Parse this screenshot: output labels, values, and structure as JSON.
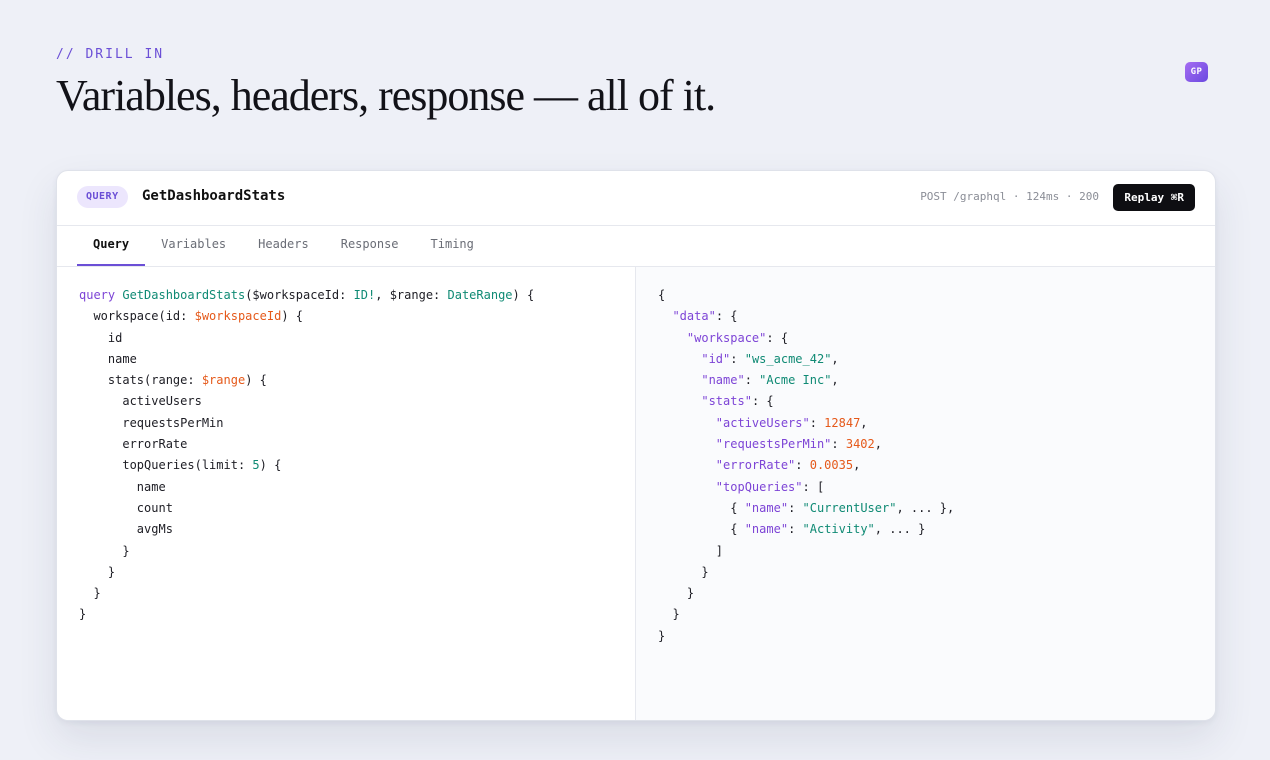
{
  "section": {
    "eyebrow": "// DRILL IN",
    "headline": "Variables, headers, response — all of it.",
    "corner_badge": "GP"
  },
  "panel": {
    "op_type": "QUERY",
    "op_name": "GetDashboardStats",
    "meta": "POST /graphql · 124ms · 200",
    "replay_label": "Replay ⌘R",
    "tabs": [
      "Query",
      "Variables",
      "Headers",
      "Response",
      "Timing"
    ],
    "active_tab": "Query"
  },
  "query_lines": [
    {
      "indent": 0,
      "parts": [
        [
          "kw",
          "query "
        ],
        [
          "fn",
          "GetDashboardStats"
        ],
        [
          "",
          "($workspaceId: "
        ],
        [
          "ty",
          "ID!"
        ],
        [
          "",
          ", $range: "
        ],
        [
          "ty",
          "DateRange"
        ],
        [
          "",
          ") {"
        ]
      ]
    },
    {
      "indent": 1,
      "parts": [
        [
          "",
          "workspace(id: "
        ],
        [
          "var",
          "$workspaceId"
        ],
        [
          "",
          ") {"
        ]
      ]
    },
    {
      "indent": 2,
      "parts": [
        [
          "",
          "id"
        ]
      ]
    },
    {
      "indent": 2,
      "parts": [
        [
          "",
          "name"
        ]
      ]
    },
    {
      "indent": 2,
      "parts": [
        [
          "",
          "stats(range: "
        ],
        [
          "var",
          "$range"
        ],
        [
          "",
          ") {"
        ]
      ]
    },
    {
      "indent": 3,
      "parts": [
        [
          "",
          "activeUsers"
        ]
      ]
    },
    {
      "indent": 3,
      "parts": [
        [
          "",
          "requestsPerMin"
        ]
      ]
    },
    {
      "indent": 3,
      "parts": [
        [
          "",
          "errorRate"
        ]
      ]
    },
    {
      "indent": 3,
      "parts": [
        [
          "",
          "topQueries(limit: "
        ],
        [
          "num",
          "5"
        ],
        [
          "",
          ") {"
        ]
      ]
    },
    {
      "indent": 4,
      "parts": [
        [
          "",
          "name"
        ]
      ]
    },
    {
      "indent": 4,
      "parts": [
        [
          "",
          "count"
        ]
      ]
    },
    {
      "indent": 4,
      "parts": [
        [
          "",
          "avgMs"
        ]
      ]
    },
    {
      "indent": 3,
      "parts": [
        [
          "",
          "}"
        ]
      ]
    },
    {
      "indent": 2,
      "parts": [
        [
          "",
          "}"
        ]
      ]
    },
    {
      "indent": 1,
      "parts": [
        [
          "",
          "}"
        ]
      ]
    },
    {
      "indent": 0,
      "parts": [
        [
          "",
          "}"
        ]
      ]
    }
  ],
  "response_lines": [
    {
      "indent": 0,
      "parts": [
        [
          "",
          "{"
        ]
      ]
    },
    {
      "indent": 1,
      "parts": [
        [
          "key",
          "\"data\""
        ],
        [
          "",
          ": {"
        ]
      ]
    },
    {
      "indent": 2,
      "parts": [
        [
          "key",
          "\"workspace\""
        ],
        [
          "",
          ": {"
        ]
      ]
    },
    {
      "indent": 3,
      "parts": [
        [
          "key",
          "\"id\""
        ],
        [
          "",
          ": "
        ],
        [
          "str",
          "\"ws_acme_42\""
        ],
        [
          "",
          ","
        ]
      ]
    },
    {
      "indent": 3,
      "parts": [
        [
          "key",
          "\"name\""
        ],
        [
          "",
          ": "
        ],
        [
          "str",
          "\"Acme Inc\""
        ],
        [
          "",
          ","
        ]
      ]
    },
    {
      "indent": 3,
      "parts": [
        [
          "key",
          "\"stats\""
        ],
        [
          "",
          ": {"
        ]
      ]
    },
    {
      "indent": 4,
      "parts": [
        [
          "key",
          "\"activeUsers\""
        ],
        [
          "",
          ": "
        ],
        [
          "jnum",
          "12847"
        ],
        [
          "",
          ","
        ]
      ]
    },
    {
      "indent": 4,
      "parts": [
        [
          "key",
          "\"requestsPerMin\""
        ],
        [
          "",
          ": "
        ],
        [
          "jnum",
          "3402"
        ],
        [
          "",
          ","
        ]
      ]
    },
    {
      "indent": 4,
      "parts": [
        [
          "key",
          "\"errorRate\""
        ],
        [
          "",
          ": "
        ],
        [
          "jnum",
          "0.0035"
        ],
        [
          "",
          ","
        ]
      ]
    },
    {
      "indent": 4,
      "parts": [
        [
          "key",
          "\"topQueries\""
        ],
        [
          "",
          ": ["
        ]
      ]
    },
    {
      "indent": 5,
      "parts": [
        [
          "",
          "{ "
        ],
        [
          "key",
          "\"name\""
        ],
        [
          "",
          ": "
        ],
        [
          "str",
          "\"CurrentUser\""
        ],
        [
          "",
          ", ... },"
        ]
      ]
    },
    {
      "indent": 5,
      "parts": [
        [
          "",
          "{ "
        ],
        [
          "key",
          "\"name\""
        ],
        [
          "",
          ": "
        ],
        [
          "str",
          "\"Activity\""
        ],
        [
          "",
          ", ... }"
        ]
      ]
    },
    {
      "indent": 4,
      "parts": [
        [
          "",
          "]"
        ]
      ]
    },
    {
      "indent": 3,
      "parts": [
        [
          "",
          "}"
        ]
      ]
    },
    {
      "indent": 2,
      "parts": [
        [
          "",
          "}"
        ]
      ]
    },
    {
      "indent": 1,
      "parts": [
        [
          "",
          "}"
        ]
      ]
    },
    {
      "indent": 0,
      "parts": [
        [
          "",
          "}"
        ]
      ]
    }
  ],
  "colors": {
    "accent": "#6b4fd6",
    "keyword": "#7d44d6",
    "type": "#0f8a74",
    "variable": "#e5591a",
    "json_number": "#e5591a",
    "json_string": "#0f8a74"
  }
}
